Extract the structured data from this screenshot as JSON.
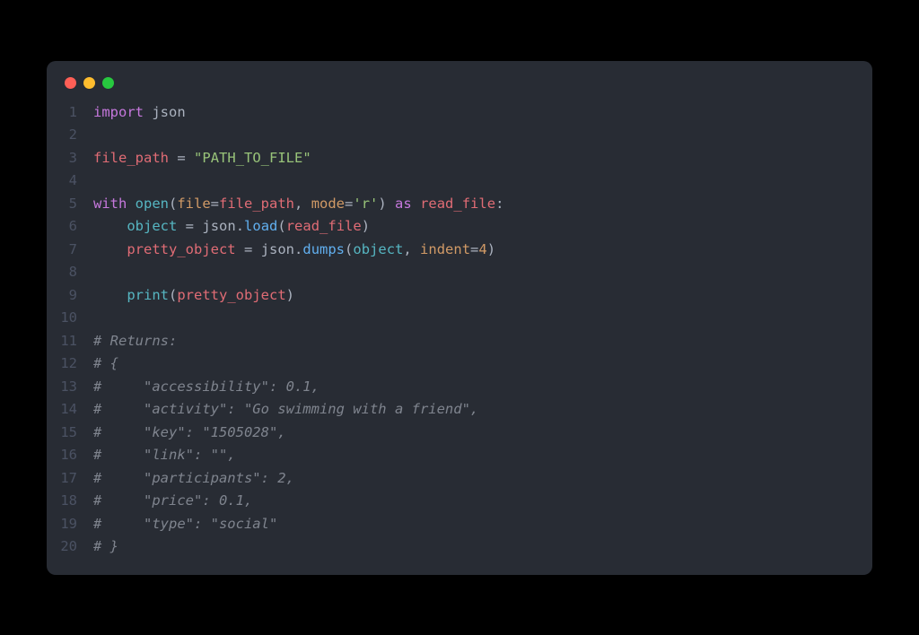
{
  "window": {
    "traffic_lights": [
      "red",
      "yellow",
      "green"
    ]
  },
  "code": {
    "lines": [
      {
        "n": 1,
        "tokens": [
          [
            "kw",
            "import"
          ],
          [
            "white",
            " "
          ],
          [
            "mod",
            "json"
          ]
        ]
      },
      {
        "n": 2,
        "tokens": []
      },
      {
        "n": 3,
        "tokens": [
          [
            "var",
            "file_path"
          ],
          [
            "white",
            " "
          ],
          [
            "op",
            "="
          ],
          [
            "white",
            " "
          ],
          [
            "str",
            "\"PATH_TO_FILE\""
          ]
        ]
      },
      {
        "n": 4,
        "tokens": []
      },
      {
        "n": 5,
        "tokens": [
          [
            "kw",
            "with"
          ],
          [
            "white",
            " "
          ],
          [
            "builtin",
            "open"
          ],
          [
            "punct",
            "("
          ],
          [
            "param",
            "file"
          ],
          [
            "op",
            "="
          ],
          [
            "var",
            "file_path"
          ],
          [
            "punct",
            ", "
          ],
          [
            "param",
            "mode"
          ],
          [
            "op",
            "="
          ],
          [
            "str",
            "'r'"
          ],
          [
            "punct",
            ")"
          ],
          [
            "white",
            " "
          ],
          [
            "kw",
            "as"
          ],
          [
            "white",
            " "
          ],
          [
            "var",
            "read_file"
          ],
          [
            "punct",
            ":"
          ]
        ]
      },
      {
        "n": 6,
        "tokens": [
          [
            "white",
            "    "
          ],
          [
            "builtin",
            "object"
          ],
          [
            "white",
            " "
          ],
          [
            "op",
            "="
          ],
          [
            "white",
            " "
          ],
          [
            "obj",
            "json"
          ],
          [
            "punct",
            "."
          ],
          [
            "fn",
            "load"
          ],
          [
            "punct",
            "("
          ],
          [
            "var",
            "read_file"
          ],
          [
            "punct",
            ")"
          ]
        ]
      },
      {
        "n": 7,
        "tokens": [
          [
            "white",
            "    "
          ],
          [
            "var",
            "pretty_object"
          ],
          [
            "white",
            " "
          ],
          [
            "op",
            "="
          ],
          [
            "white",
            " "
          ],
          [
            "obj",
            "json"
          ],
          [
            "punct",
            "."
          ],
          [
            "fn",
            "dumps"
          ],
          [
            "punct",
            "("
          ],
          [
            "builtin",
            "object"
          ],
          [
            "punct",
            ", "
          ],
          [
            "param",
            "indent"
          ],
          [
            "op",
            "="
          ],
          [
            "num",
            "4"
          ],
          [
            "punct",
            ")"
          ]
        ]
      },
      {
        "n": 8,
        "tokens": []
      },
      {
        "n": 9,
        "tokens": [
          [
            "white",
            "    "
          ],
          [
            "builtin",
            "print"
          ],
          [
            "punct",
            "("
          ],
          [
            "var",
            "pretty_object"
          ],
          [
            "punct",
            ")"
          ]
        ]
      },
      {
        "n": 10,
        "tokens": []
      },
      {
        "n": 11,
        "tokens": [
          [
            "comment",
            "# Returns:"
          ]
        ]
      },
      {
        "n": 12,
        "tokens": [
          [
            "comment",
            "# {"
          ]
        ]
      },
      {
        "n": 13,
        "tokens": [
          [
            "comment",
            "#     \"accessibility\": 0.1,"
          ]
        ]
      },
      {
        "n": 14,
        "tokens": [
          [
            "comment",
            "#     \"activity\": \"Go swimming with a friend\","
          ]
        ]
      },
      {
        "n": 15,
        "tokens": [
          [
            "comment",
            "#     \"key\": \"1505028\","
          ]
        ]
      },
      {
        "n": 16,
        "tokens": [
          [
            "comment",
            "#     \"link\": \"\","
          ]
        ]
      },
      {
        "n": 17,
        "tokens": [
          [
            "comment",
            "#     \"participants\": 2,"
          ]
        ]
      },
      {
        "n": 18,
        "tokens": [
          [
            "comment",
            "#     \"price\": 0.1,"
          ]
        ]
      },
      {
        "n": 19,
        "tokens": [
          [
            "comment",
            "#     \"type\": \"social\""
          ]
        ]
      },
      {
        "n": 20,
        "tokens": [
          [
            "comment",
            "# }"
          ]
        ]
      }
    ]
  }
}
